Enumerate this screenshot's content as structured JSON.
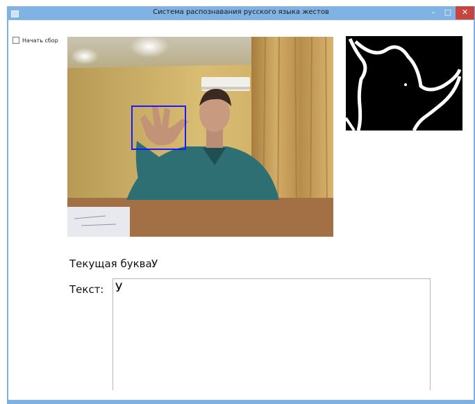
{
  "window": {
    "title": "Система распознавания русского языка жестов",
    "controls": {
      "minimize": "–",
      "maximize": "□",
      "close": "✕"
    }
  },
  "controls": {
    "start_collection_label": "Начать сбор",
    "start_collection_checked": false
  },
  "recognition": {
    "current_letter_label": "Текущая буква:",
    "current_letter_value": "У",
    "text_label": "Текст:",
    "text_value": "У"
  },
  "colors": {
    "titlebar": "#80b3e3",
    "close_button": "#c7453f",
    "detection_box": "#1a1aff"
  }
}
